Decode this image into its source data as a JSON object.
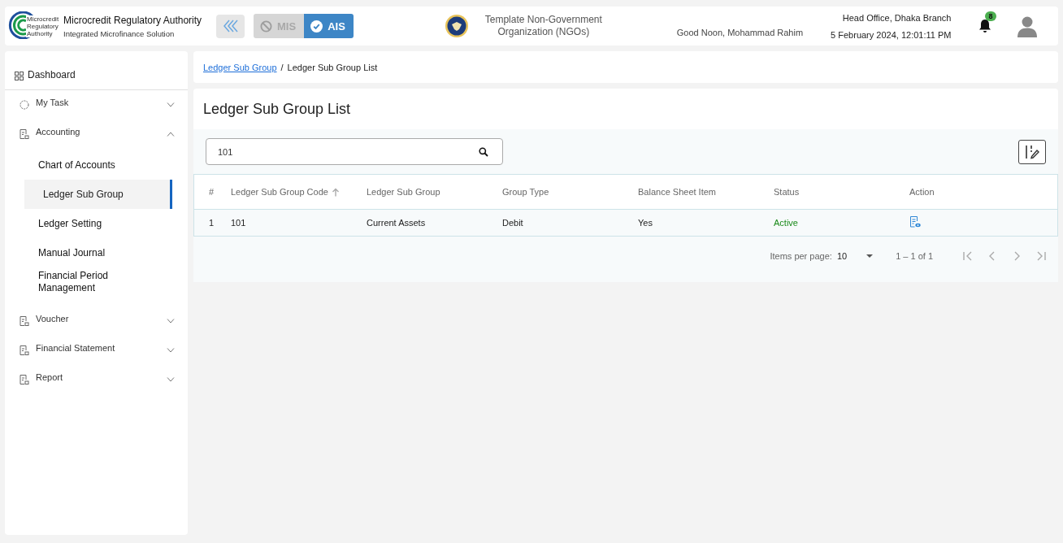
{
  "header": {
    "logo_text": [
      "Microcredit",
      "Regulatory",
      "Authority"
    ],
    "title": "Microcredit Regulatory Authority",
    "subtitle": "Integrated Microfinance Solution",
    "modules": [
      {
        "label": "MIS",
        "selected": false
      },
      {
        "label": "AIS",
        "selected": true
      }
    ],
    "organization": "Template Non-Government Organization (NGOs)",
    "greeting": "Good Noon, Mohammad Rahim",
    "branch": "Head Office, Dhaka Branch",
    "datetime": "5 February 2024, 12:01:11 PM",
    "notifications": "8"
  },
  "sidebar": {
    "dashboard": "Dashboard",
    "items": [
      {
        "label": "My Task",
        "kind": "task",
        "expanded": false
      },
      {
        "label": "Accounting",
        "kind": "module",
        "expanded": true,
        "children": [
          {
            "label": "Chart of Accounts",
            "selected": false
          },
          {
            "label": "Ledger Sub Group",
            "selected": true
          },
          {
            "label": "Ledger Setting",
            "selected": false
          },
          {
            "label": "Manual Journal",
            "selected": false
          },
          {
            "label": "Financial Period Management",
            "selected": false
          }
        ]
      },
      {
        "label": "Voucher",
        "kind": "module",
        "expanded": false
      },
      {
        "label": "Financial Statement",
        "kind": "module",
        "expanded": false
      },
      {
        "label": "Report",
        "kind": "module",
        "expanded": false
      }
    ]
  },
  "breadcrumb": {
    "link": "Ledger Sub Group",
    "separator": "/",
    "current": "Ledger Sub Group List"
  },
  "page_title": "Ledger Sub Group List",
  "search": {
    "value": "101"
  },
  "table": {
    "columns": [
      {
        "label": "#",
        "sorted": false
      },
      {
        "label": "Ledger Sub Group Code",
        "sorted": true
      },
      {
        "label": "Ledger Sub Group",
        "sorted": false
      },
      {
        "label": "Group Type",
        "sorted": false
      },
      {
        "label": "Balance Sheet Item",
        "sorted": false
      },
      {
        "label": "Status",
        "sorted": false
      },
      {
        "label": "Action",
        "sorted": false
      }
    ],
    "rows": [
      {
        "index": "1",
        "code": "101",
        "group": "Current Assets",
        "type": "Debit",
        "balance_sheet": "Yes",
        "status": "Active",
        "color": "#1a8a1a"
      }
    ]
  },
  "paginator": {
    "label": "Items per page:",
    "page_size": "10",
    "range": "1 – 1 of 1"
  }
}
